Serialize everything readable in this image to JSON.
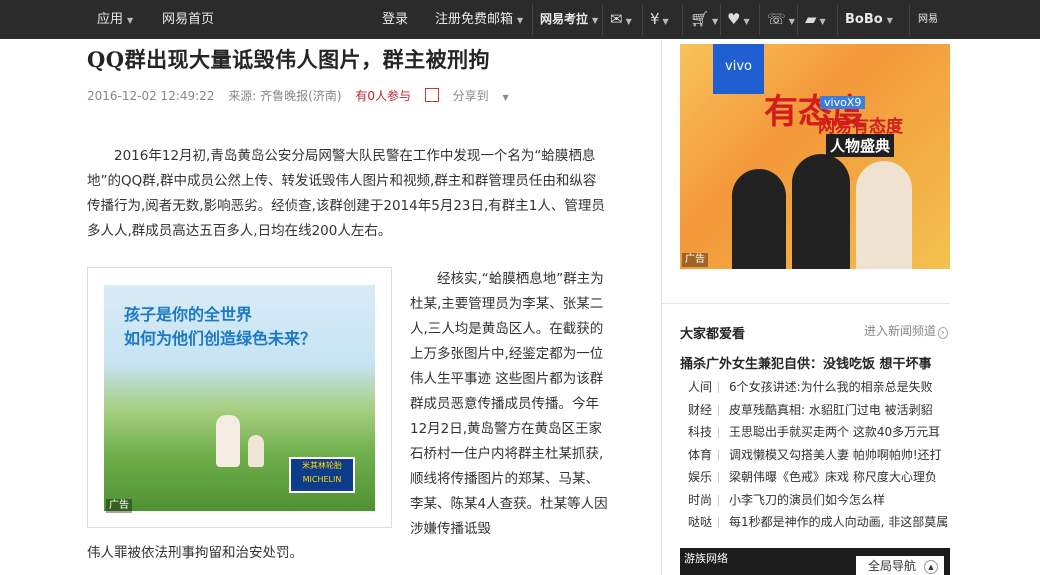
{
  "topbar": {
    "apps": "应用",
    "home": "网易首页",
    "login": "登录",
    "register": "注册免费邮箱",
    "kaola": "网易考拉",
    "bobo": "BoBo",
    "right_cut": "网易"
  },
  "article": {
    "title": "QQ群出现大量诋毁伟人图片，群主被刑拘",
    "time": "2016-12-02 12:49:22",
    "source": "来源: 齐鲁晚报(济南)",
    "participants": "有0人参与",
    "share": "分享到",
    "p1": "2016年12月初,青岛黄岛公安分局网警大队民警在工作中发现一个名为“蛤膜栖息地”的QQ群,群中成员公然上传、转发诋毁伟人图片和视频,群主和群管理员任由和纵容传播行为,阅者无数,影响恶劣。经侦查,该群创建于2014年5月23日,有群主1人、管理员多人人,群成员高达五百多人,日均在线200人左右。",
    "p2": "经核实,“蛤膜栖息地”群主为杜某,主要管理员为李某、张某二人,三人均是黄岛区人。在截获的上万多张图片中,经鉴定都为一位伟人生平事迹 这些图片都为该群群成员恶意传播成员传播。今年12月2日,黄岛警方在黄岛区王家石桥村一住户内将群主杜某抓获,顺线将传播图片的郑某、马某、李某、陈某4人查获。杜某等人因涉嫌传播诋毁",
    "p3": "伟人罪被依法刑事拘留和治安处罚。"
  },
  "inline_ad": {
    "line1": "孩子是你的全世界",
    "line2": "如何为他们创造绿色未来？",
    "brand": "米其林轮胎 MICHELIN",
    "tag": "广告"
  },
  "side_ad": {
    "vivo": "vivo",
    "big": "有态度",
    "model": "vivoX9",
    "slogan": "网易有态度",
    "sub": "人物盛典",
    "tag": "广告"
  },
  "popular": {
    "title": "大家都爱看",
    "more": "进入新闻频道",
    "headline": "捅杀广外女生兼犯自供：没钱吃饭 想干坏事",
    "items": [
      {
        "cat": "人间",
        "text": "6个女孩讲述:为什么我的相亲总是失败"
      },
      {
        "cat": "财经",
        "text": "皮草残酷真相: 水貂肛门过电 被活剥貂"
      },
      {
        "cat": "科技",
        "text": "王思聪出手就买走两个 这款40多万元耳"
      },
      {
        "cat": "体育",
        "text": "调戏懒模又勾搭美人妻 帕帅啊帕帅!还打"
      },
      {
        "cat": "娱乐",
        "text": "梁朝伟曝《色戒》床戏 称尺度大心理负"
      },
      {
        "cat": "时尚",
        "text": "小李飞刀的演员们如今怎么样"
      },
      {
        "cat": "哒哒",
        "text": "每1秒都是神作的成人向动画, 非这部莫属"
      }
    ]
  },
  "game_bar": {
    "logo": "游族网络",
    "nav": "全局导航"
  }
}
